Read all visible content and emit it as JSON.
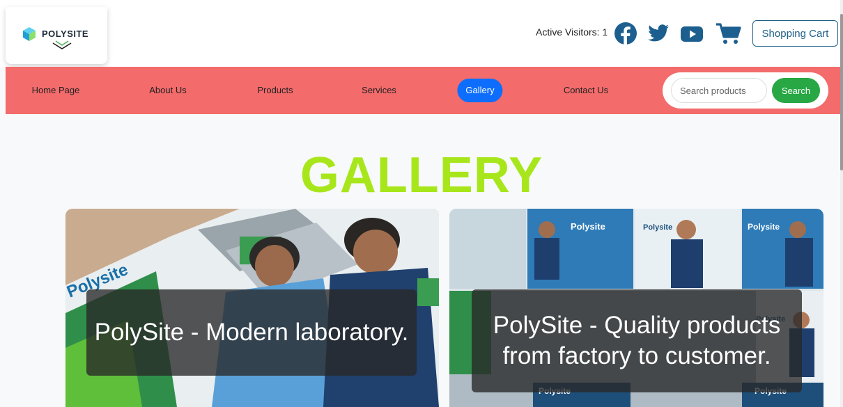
{
  "header": {
    "logo_text": "POLYSITE",
    "visitors_text": "Active Visitors: 1",
    "social": [
      "facebook-icon",
      "twitter-icon",
      "youtube-icon"
    ],
    "cart_icon": "cart-icon",
    "cart_label": "Shopping Cart"
  },
  "nav": {
    "items": [
      {
        "label": "Home Page"
      },
      {
        "label": "About Us"
      },
      {
        "label": "Products"
      },
      {
        "label": "Services"
      },
      {
        "label": "Gallery",
        "active": true
      },
      {
        "label": "Contact Us"
      }
    ],
    "search_placeholder": "Search products",
    "search_button": "Search"
  },
  "gallery": {
    "title": "GALLERY",
    "cards": [
      {
        "caption": "PolySite - Modern laboratory."
      },
      {
        "caption": "PolySite - Quality products from factory to customer."
      }
    ]
  },
  "colors": {
    "nav_bg": "#f36b6b",
    "accent_blue": "#0d6efd",
    "search_green": "#28a745",
    "title_green": "#a8e61c",
    "facebook": "#1877f2",
    "twitter": "#1c6fb8",
    "youtube": "#1c5f8f",
    "cart": "#1c5f8f"
  }
}
